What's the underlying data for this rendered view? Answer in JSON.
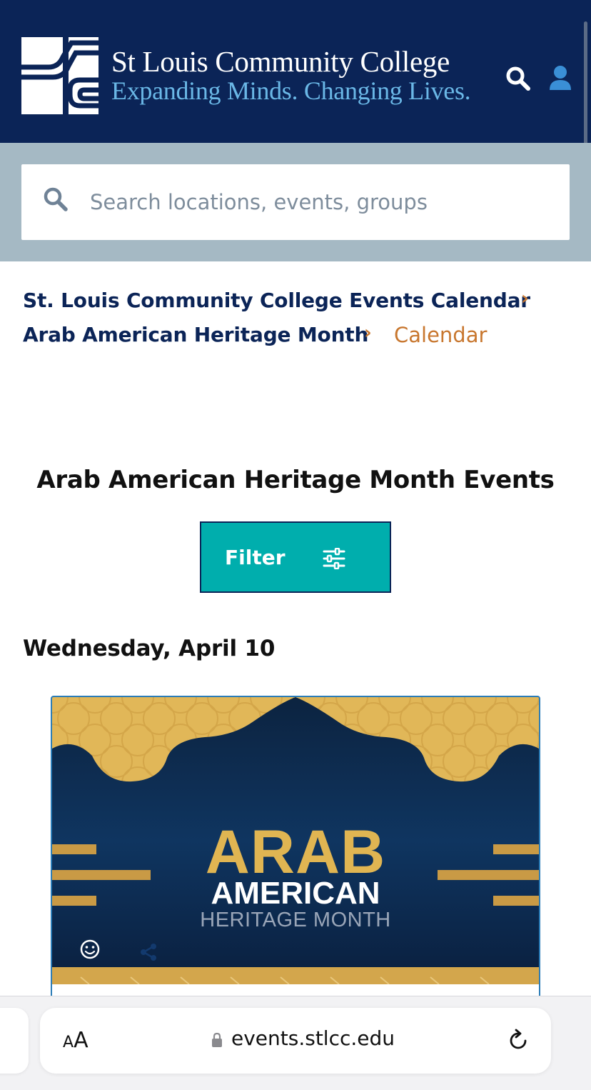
{
  "header": {
    "college_name": "St Louis Community College",
    "tagline": "Expanding Minds. Changing Lives.",
    "logo_icon": "stlcc-logo",
    "search_icon": "search-icon",
    "account_icon": "user-icon"
  },
  "search": {
    "placeholder": "Search locations, events, groups",
    "value": ""
  },
  "breadcrumbs": {
    "items": [
      {
        "label": "St. Louis Community College Events Calendar"
      },
      {
        "label": "Arab American Heritage Month"
      }
    ],
    "current": "Calendar",
    "separator": "›"
  },
  "main": {
    "title": "Arab American Heritage Month Events",
    "filter_label": "Filter",
    "date_heading": "Wednesday, April 10"
  },
  "event_card": {
    "banner_line_1": "ARAB",
    "banner_line_2": "AMERICAN",
    "banner_line_3": "HERITAGE MONTH"
  },
  "browser": {
    "text_size_small": "A",
    "text_size_big": "A",
    "url": "events.stlcc.edu"
  },
  "colors": {
    "header_bg": "#0b2457",
    "accent_teal": "#00aead",
    "breadcrumb_orange": "#c8772f",
    "tagline_blue": "#6ab7e6",
    "search_band": "#a5b9c4"
  }
}
